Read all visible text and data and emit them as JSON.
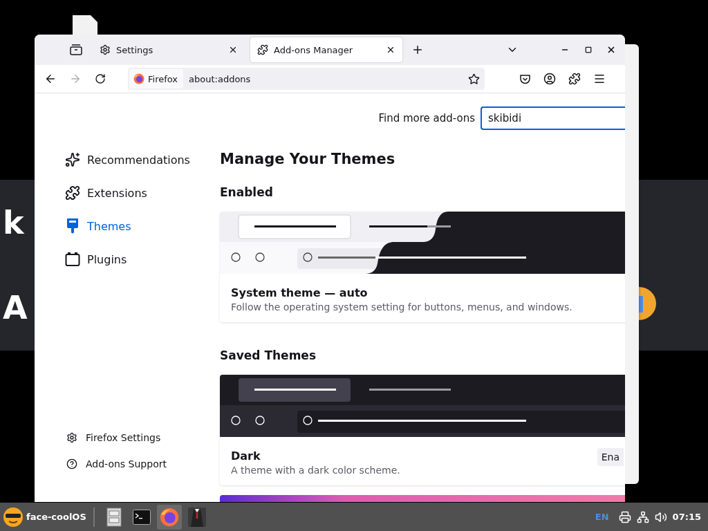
{
  "desktop": {
    "background_texts": [
      "k",
      "A"
    ]
  },
  "browser": {
    "tabs": [
      {
        "label": "Settings",
        "selected": false
      },
      {
        "label": "Add-ons Manager",
        "selected": true
      }
    ],
    "navigation": [
      {
        "kind": "back",
        "disabled": false
      },
      {
        "kind": "forward",
        "disabled": true
      },
      {
        "kind": "reload",
        "disabled": false
      }
    ],
    "identity": "Firefox",
    "url": "about:addons"
  },
  "sidebar": {
    "items": [
      {
        "kind": "recommendations",
        "label": "Recommendations",
        "selected": false
      },
      {
        "kind": "extensions",
        "label": "Extensions",
        "selected": false
      },
      {
        "kind": "themes",
        "label": "Themes",
        "selected": true
      },
      {
        "kind": "plugins",
        "label": "Plugins",
        "selected": false
      }
    ],
    "footer": [
      {
        "kind": "settings",
        "label": "Firefox Settings"
      },
      {
        "kind": "support",
        "label": "Add-ons Support"
      }
    ]
  },
  "search": {
    "label": "Find more add-ons",
    "value": "skibidi"
  },
  "heading": "Manage Your Themes",
  "sections": [
    {
      "title": "Enabled",
      "themes": [
        {
          "kind": "auto",
          "name": "System theme — auto",
          "description": "Follow the operating system setting for buttons, menus, and windows."
        }
      ]
    },
    {
      "title": "Saved Themes",
      "themes": [
        {
          "kind": "dark",
          "name": "Dark",
          "description": "A theme with a dark color scheme.",
          "button": "Ena"
        },
        {
          "kind": "colorful"
        }
      ]
    }
  ],
  "taskbar": {
    "start_label": "face-coolOS",
    "apps": [
      {
        "kind": "files",
        "selected": false
      },
      {
        "kind": "terminal",
        "selected": false
      },
      {
        "kind": "browser",
        "selected": true
      },
      {
        "kind": "suit",
        "selected": false
      }
    ],
    "language": "EN",
    "clock": "07:15"
  }
}
